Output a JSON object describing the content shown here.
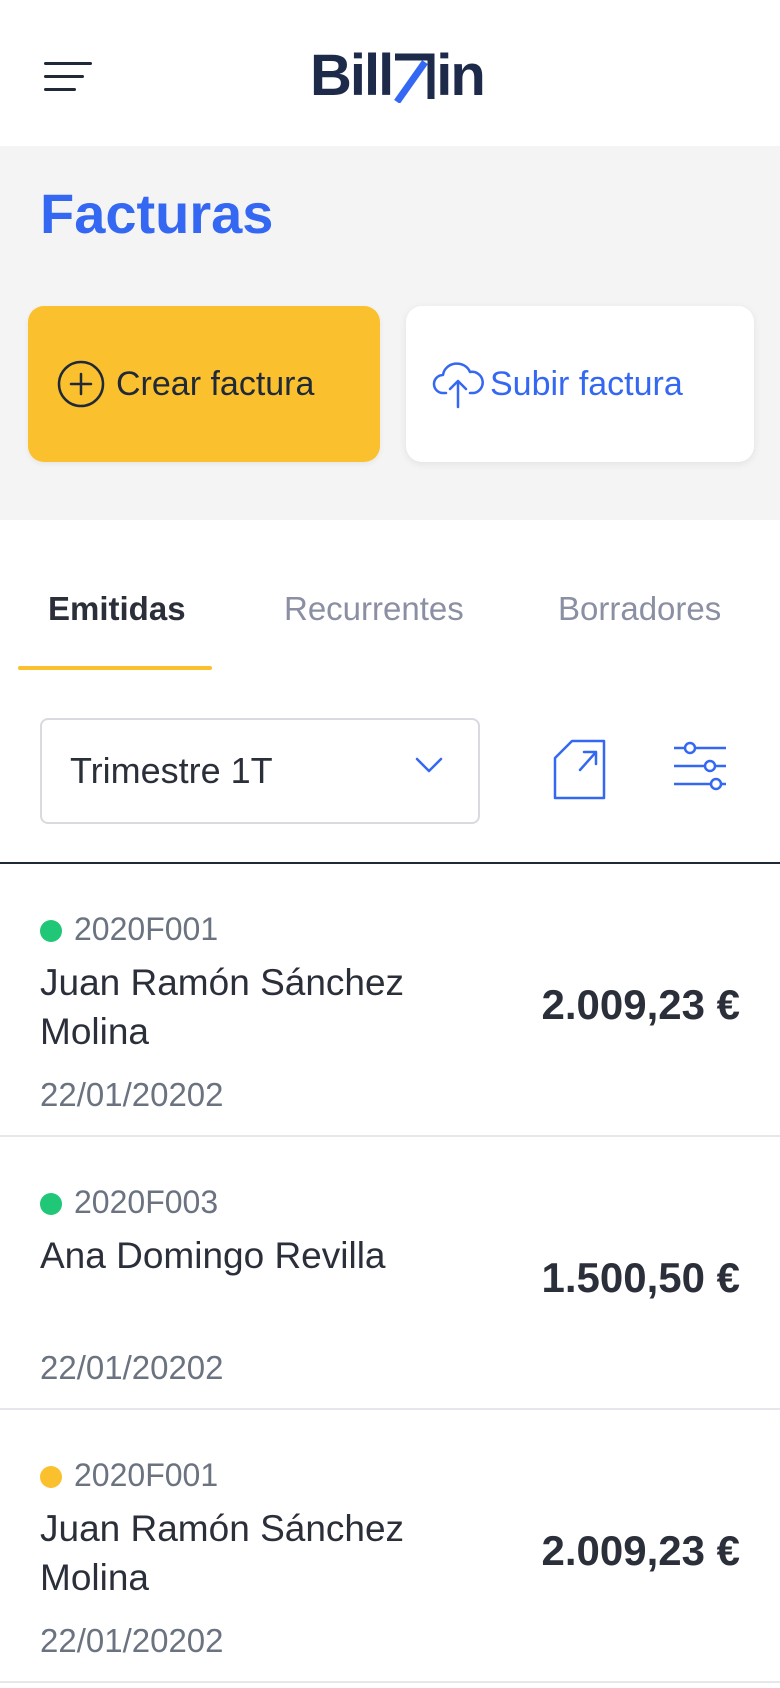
{
  "header": {
    "logo_left": "Bill",
    "logo_right": "in",
    "logo_accent_color": "#3568f2"
  },
  "hero": {
    "title": "Facturas",
    "create_button": "Crear factura",
    "upload_button": "Subir factura"
  },
  "tabs": [
    {
      "label": "Emitidas",
      "active": true
    },
    {
      "label": "Recurrentes",
      "active": false
    },
    {
      "label": "Borradores",
      "active": false
    }
  ],
  "filters": {
    "period_selected": "Trimestre 1T"
  },
  "invoices": [
    {
      "id": "2020F001",
      "status_color": "#1fc777",
      "client": "Juan Ramón Sánchez Molina",
      "date": "22/01/20202",
      "amount": "2.009,23 €"
    },
    {
      "id": "2020F003",
      "status_color": "#1fc777",
      "client": "Ana Domingo Revilla",
      "date": "22/01/20202",
      "amount": "1.500,50 €"
    },
    {
      "id": "2020F001",
      "status_color": "#fbc02d",
      "client": "Juan Ramón Sánchez Molina",
      "date": "22/01/20202",
      "amount": "2.009,23 €"
    }
  ],
  "colors": {
    "primary": "#3568f2",
    "accent_yellow": "#fbc02d",
    "status_green": "#1fc777",
    "status_yellow": "#fbc02d"
  },
  "icons": {
    "menu": "hamburger-menu-icon",
    "create": "plus-circle-icon",
    "upload": "cloud-upload-icon",
    "select": "chevron-down-icon",
    "export": "export-document-icon",
    "filter": "filter-sliders-icon"
  }
}
